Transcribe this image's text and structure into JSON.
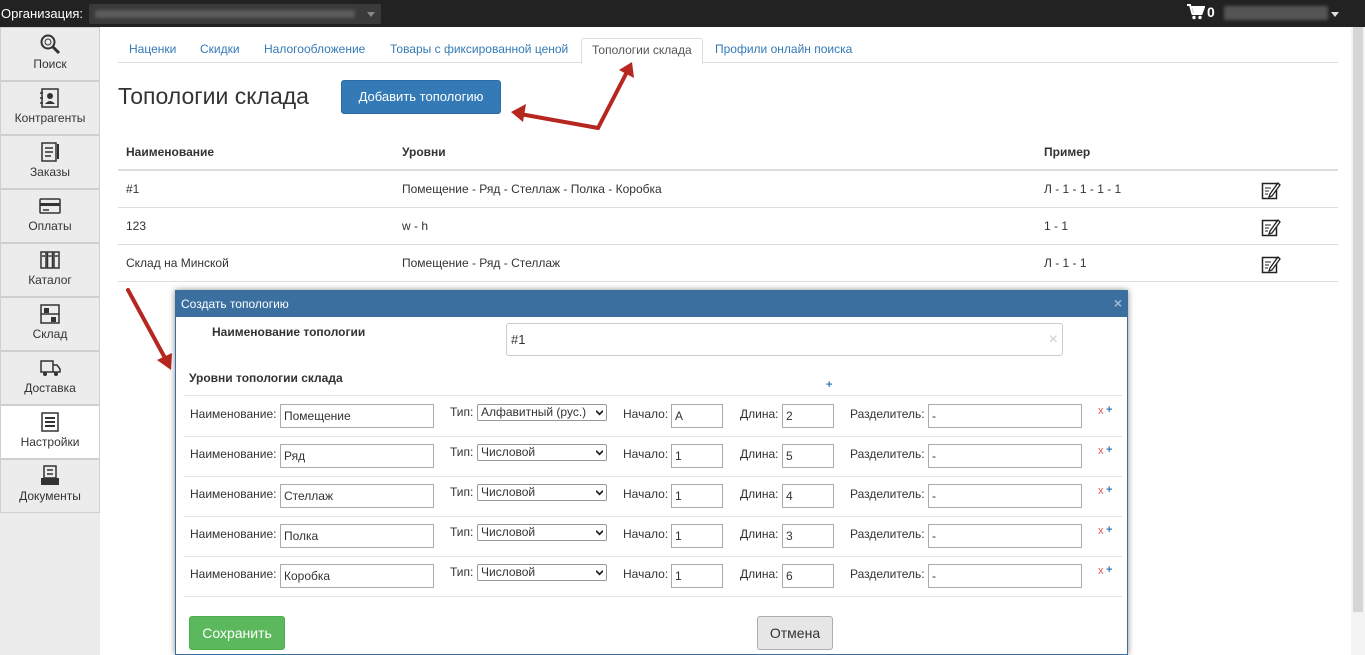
{
  "topbar": {
    "org_label": "Организация:",
    "cart_count": "0"
  },
  "sidebar": {
    "items": [
      {
        "label": "Поиск",
        "icon": "search-icon"
      },
      {
        "label": "Контрагенты",
        "icon": "contacts-icon"
      },
      {
        "label": "Заказы",
        "icon": "orders-icon"
      },
      {
        "label": "Оплаты",
        "icon": "payments-icon"
      },
      {
        "label": "Каталог",
        "icon": "catalog-icon"
      },
      {
        "label": "Склад",
        "icon": "warehouse-icon"
      },
      {
        "label": "Доставка",
        "icon": "delivery-icon"
      },
      {
        "label": "Настройки",
        "icon": "settings-icon"
      },
      {
        "label": "Документы",
        "icon": "documents-icon"
      }
    ],
    "active_index": 7
  },
  "tabs": [
    {
      "label": "Наценки"
    },
    {
      "label": "Скидки"
    },
    {
      "label": "Налогообложение"
    },
    {
      "label": "Товары с фиксированной ценой"
    },
    {
      "label": "Топологии склада"
    },
    {
      "label": "Профили онлайн поиска"
    }
  ],
  "active_tab": 4,
  "page": {
    "title": "Топологии склада",
    "add_button": "Добавить топологию"
  },
  "table": {
    "headers": {
      "name": "Наименование",
      "levels": "Уровни",
      "example": "Пример"
    },
    "rows": [
      {
        "name": "#1",
        "levels": "Помещение - Ряд - Стеллаж - Полка - Коробка",
        "example": "Л - 1 - 1 - 1 - 1"
      },
      {
        "name": "123",
        "levels": "w - h",
        "example": "1 - 1"
      },
      {
        "name": "Склад на Минской",
        "levels": "Помещение - Ряд - Стеллаж",
        "example": "Л - 1 - 1"
      }
    ]
  },
  "modal": {
    "title": "Создать топологию",
    "close": "×",
    "name_label": "Наименование топологии",
    "name_value": "#1",
    "clear": "×",
    "levels_label": "Уровни топологии склада",
    "add_level": "+",
    "field_labels": {
      "name": "Наименование:",
      "type": "Тип:",
      "start": "Начало:",
      "length": "Длина:",
      "separator": "Разделитель:"
    },
    "remove_glyph": "x",
    "add_glyph": "+",
    "levels": [
      {
        "name": "Помещение",
        "type": "Алфавитный (рус.)",
        "start": "А",
        "length": "2",
        "separator": "-"
      },
      {
        "name": "Ряд",
        "type": "Числовой",
        "start": "1",
        "length": "5",
        "separator": "-"
      },
      {
        "name": "Стеллаж",
        "type": "Числовой",
        "start": "1",
        "length": "4",
        "separator": "-"
      },
      {
        "name": "Полка",
        "type": "Числовой",
        "start": "1",
        "length": "3",
        "separator": "-"
      },
      {
        "name": "Коробка",
        "type": "Числовой",
        "start": "1",
        "length": "6",
        "separator": "-"
      }
    ],
    "save": "Сохранить",
    "cancel": "Отмена"
  },
  "colors": {
    "primary": "#337ab7",
    "success": "#5cb85c",
    "modal_header": "#3a6fa0",
    "arrow": "#b5271f",
    "remove": "#d9534f"
  }
}
